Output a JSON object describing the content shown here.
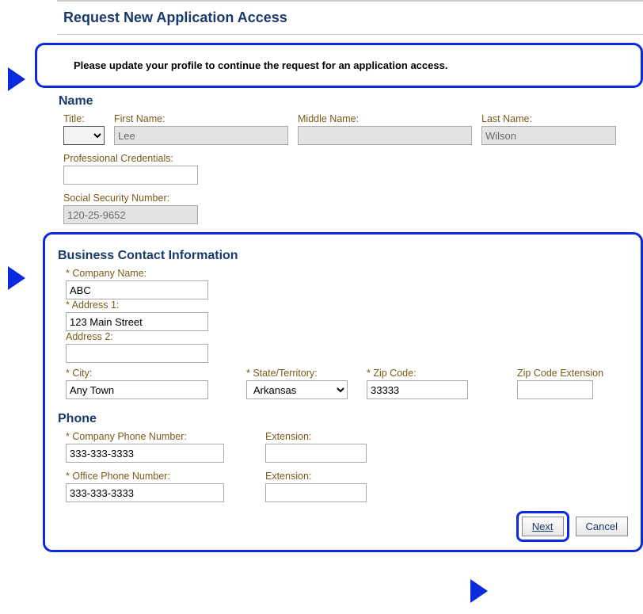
{
  "page_title": "Request New Application Access",
  "notice": "Please update your profile to continue the request for an application access.",
  "sections": {
    "name": {
      "heading": "Name",
      "title_label": "Title:",
      "first_label": "First Name:",
      "first_value": "Lee",
      "middle_label": "Middle Name:",
      "middle_value": "",
      "last_label": "Last Name:",
      "last_value": "Wilson",
      "prof_label": "Professional Credentials:",
      "prof_value": "",
      "ssn_label": "Social Security Number:",
      "ssn_value": "120-25-9652"
    },
    "bci": {
      "heading": "Business Contact Information",
      "company_label": "Company Name:",
      "company_value": "ABC",
      "addr1_label": "Address 1:",
      "addr1_value": "123 Main Street",
      "addr2_label": "Address 2:",
      "addr2_value": "",
      "city_label": "City:",
      "city_value": "Any Town",
      "state_label": "State/Territory:",
      "state_value": "Arkansas",
      "zip_label": "Zip Code:",
      "zip_value": "33333",
      "zipext_label": "Zip Code Extension",
      "zipext_value": ""
    },
    "phone": {
      "heading": "Phone",
      "company_phone_label": "Company Phone Number:",
      "company_phone_value": "333-333-3333",
      "company_ext_label": "Extension:",
      "company_ext_value": "",
      "office_phone_label": "Office Phone Number:",
      "office_phone_value": "333-333-3333",
      "office_ext_label": "Extension:",
      "office_ext_value": ""
    }
  },
  "buttons": {
    "next": "Next",
    "cancel": "Cancel"
  }
}
